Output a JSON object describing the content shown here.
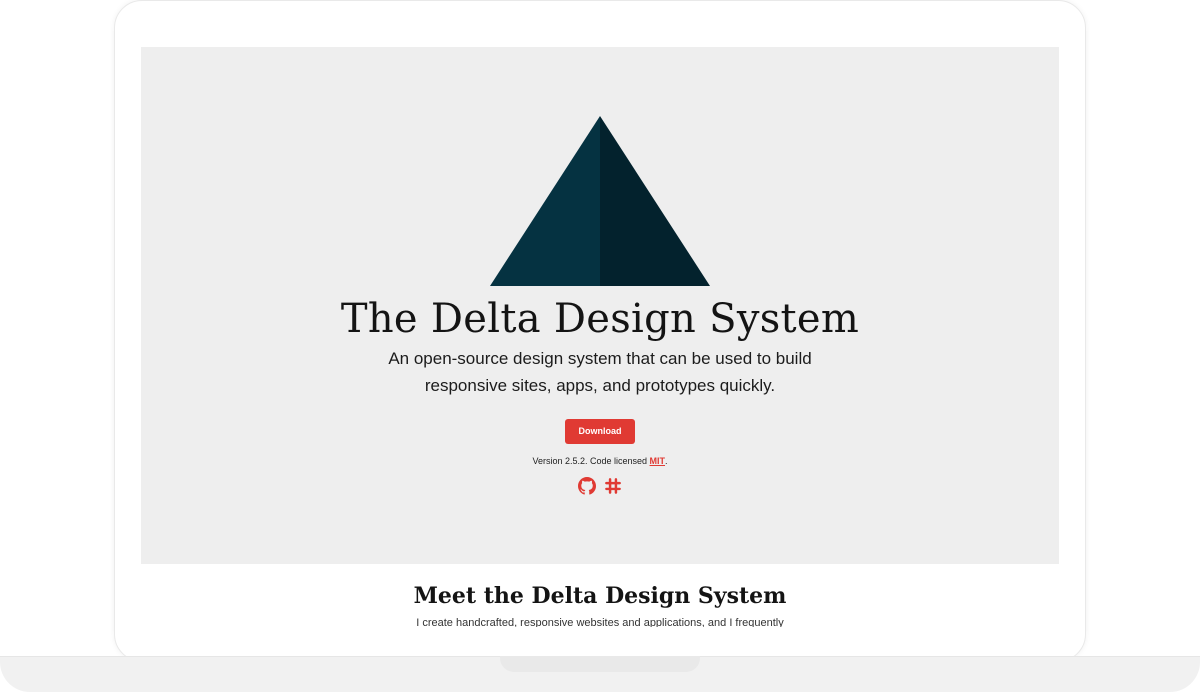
{
  "hero": {
    "title": "The Delta Design System",
    "subtitle": "An open-source design system that can be used to build responsive sites, apps, and prototypes quickly.",
    "download_label": "Download",
    "version_text": "Version 2.5.2. Code licensed ",
    "license_link": "MIT",
    "version_suffix": ".",
    "icons": [
      "github-icon",
      "slack-icon"
    ]
  },
  "section": {
    "title": "Meet the Delta Design System",
    "text_partial": "I create handcrafted, responsive websites and applications, and I frequently"
  },
  "colors": {
    "hero_bg": "#eeeeee",
    "accent": "#e03a33",
    "logo_light": "#053241",
    "logo_dark": "#03222d"
  }
}
